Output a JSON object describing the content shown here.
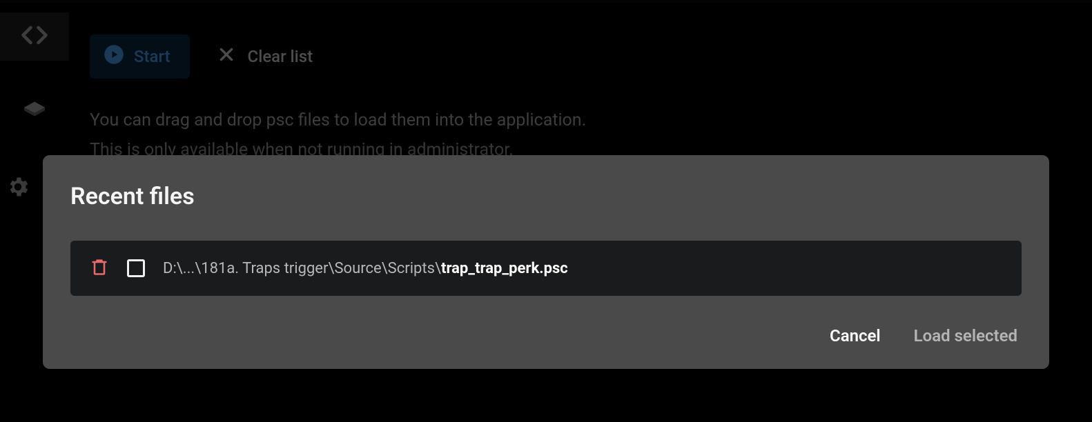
{
  "toolbar": {
    "start_label": "Start",
    "clear_label": "Clear list"
  },
  "hint": {
    "line1": "You can drag and drop psc files to load them into the application.",
    "line2": "This is only available when not running in administrator."
  },
  "dialog": {
    "title": "Recent files",
    "files": [
      {
        "dir": "D:\\...\\181a. Traps trigger\\Source\\Scripts\\",
        "name": "trap_trap_perk.psc"
      }
    ],
    "cancel_label": "Cancel",
    "load_label": "Load selected"
  }
}
